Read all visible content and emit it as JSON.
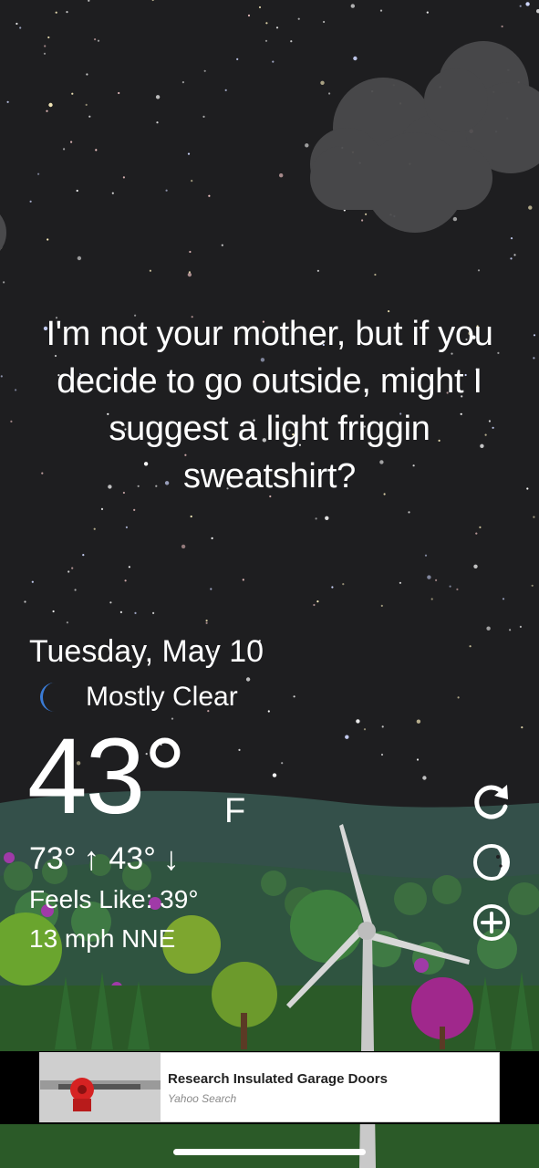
{
  "quote": "I'm not your mother, but if you decide to go outside, might I suggest a light friggin sweatshirt?",
  "date": "Tuesday, May 10",
  "condition": {
    "icon": "moon-icon",
    "text": "Mostly Clear"
  },
  "temperature": {
    "value": "43°",
    "unit": "F"
  },
  "high": "73°",
  "low": "43°",
  "high_arrow": "↑",
  "low_arrow": "↓",
  "feels_like": "Feels Like: 39°",
  "wind": "13 mph NNE",
  "actions": [
    {
      "name": "refresh-icon"
    },
    {
      "name": "moon-phase-icon"
    },
    {
      "name": "add-location-icon"
    }
  ],
  "ad": {
    "title": "Research Insulated Garage Doors",
    "source": "Yahoo Search"
  },
  "colors": {
    "sky": "#1e1e20",
    "hills": "#3a5a4a",
    "grass": "#2c5a2a",
    "moon_icon": "#3a7bd5",
    "ad_background": "#ffffff"
  }
}
